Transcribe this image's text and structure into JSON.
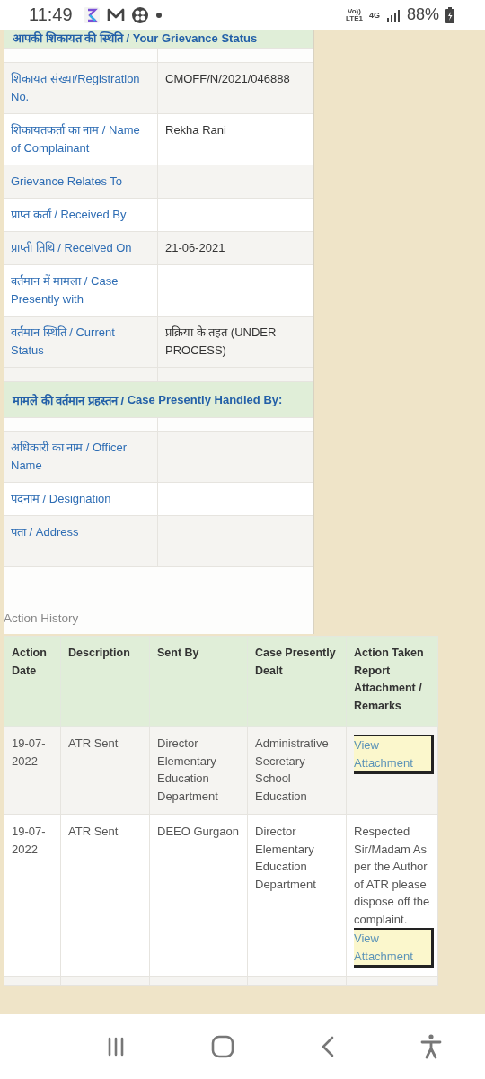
{
  "status_bar": {
    "time": "11:49",
    "volte": [
      "Vo))",
      "LTE1"
    ],
    "network": "4G",
    "battery": "88%"
  },
  "grievance_status": {
    "title_hindi": "आपकी शिकायत की स्थिति / ",
    "title": "Your Grievance Status",
    "rows": [
      {
        "label": "शिकायत संख्या/Registration No.",
        "value": "CMOFF/N/2021/046888"
      },
      {
        "label": "शिकायतकर्ता का नाम / Name of Complainant",
        "value": "Rekha Rani"
      },
      {
        "label": "Grievance Relates To"
      },
      {
        "label": "प्राप्त कर्ता / Received By"
      },
      {
        "label": "प्राप्ती तिथि / Received On",
        "value": "21-06-2021"
      },
      {
        "label": "वर्तमान में मामला / Case Presently with"
      },
      {
        "label": "वर्तमान स्थिति / Current Status",
        "value": "प्रक्रिया के तहत (UNDER PROCESS)"
      }
    ]
  },
  "case_handled_by": {
    "title_hindi": "मामले की वर्तमान प्रहस्तन / ",
    "title": "Case Presently Handled By:",
    "rows": [
      {
        "label": "अधिकारी का नाम / Officer Name"
      },
      {
        "label": "पदनाम / Designation"
      },
      {
        "label": "पता / Address"
      }
    ]
  },
  "action_history": {
    "title": "Action History",
    "columns": [
      "Action Date",
      "Description",
      "Sent By",
      "Case Presently Dealt",
      "Action Taken Report Attachment / Remarks"
    ],
    "rows": [
      {
        "date": "19-07-2022",
        "description": "ATR Sent",
        "sent_by": "Director Elementary Education Department",
        "case_presently_dealt": "Administrative Secretary School Education",
        "link": "View Attachment"
      },
      {
        "date": "19-07-2022",
        "description": "ATR Sent",
        "sent_by": "DEEO Gurgaon",
        "case_presently_dealt": "Director Elementary Education Department",
        "remarks": "Respected Sir/Madam As per the Author of ATR please dispose off the complaint.",
        "link": "View Attachment"
      }
    ]
  }
}
